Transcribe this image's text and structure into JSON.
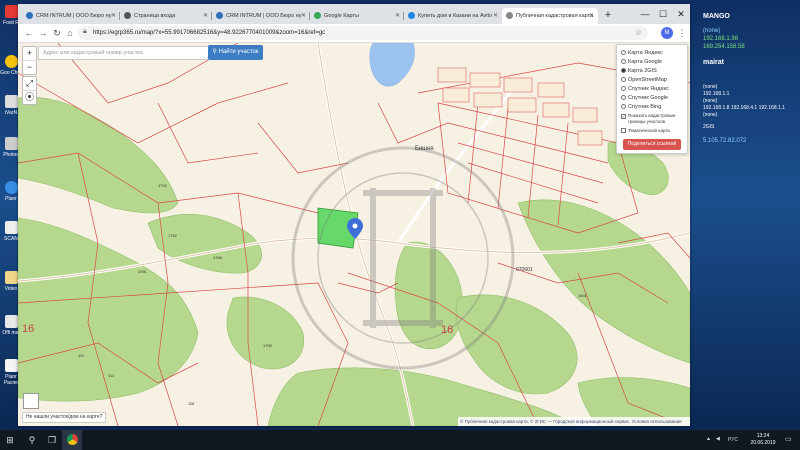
{
  "desktop": {
    "icons": [
      {
        "label": "Foxit R"
      },
      {
        "label": "Goo Chro"
      },
      {
        "label": "iVarN"
      },
      {
        "label": "Photos"
      },
      {
        "label": "Planr"
      },
      {
        "label": "SCAN"
      },
      {
        "label": "Video"
      },
      {
        "label": "Offi mai"
      },
      {
        "label": "Planr Распе"
      }
    ]
  },
  "bginfo": {
    "hostname": "MANGO",
    "none1": "(none)",
    "ip1": "192.168.1.98",
    "ip2": "169.254.158.58",
    "user": "mairat",
    "none2": "(none)",
    "ip3": "192.168.1.1",
    "none3": "(none)",
    "ip4": "192.168.1.8 192.168.4.1 192.168.1.1",
    "none4": "(none)",
    "fs": "2GIS",
    "ext_ip": "5.105.72.82.072"
  },
  "browser": {
    "tabs": [
      {
        "title": "CRM INTRUM | ООО Бюро ну",
        "color": "#2d6fb8"
      },
      {
        "title": "Страница входа",
        "color": "#555"
      },
      {
        "title": "CRM INTRUM | ООО Бюро ну",
        "color": "#2d6fb8"
      },
      {
        "title": "Google Карты",
        "color": "#34a853"
      },
      {
        "title": "Купить дом в Казани на Avito",
        "color": "#1e88e5"
      },
      {
        "title": "Публичная кадастровая карта",
        "color": "#888"
      }
    ],
    "new_tab": "+",
    "minimize": "—",
    "maximize": "☐",
    "close": "✕",
    "url": "https://egrp365.ru/map/?x=55.991706682516&y=48.9226770401009&zoom=16&ref=gc",
    "avatar_letter": "М"
  },
  "map": {
    "search_placeholder": "Адрес или кадастровый номер участка",
    "find_button": "Найти участок",
    "zoom_in": "+",
    "zoom_out": "−",
    "layers": [
      {
        "label": "Карта Яндекс",
        "selected": false
      },
      {
        "label": "Карта Google",
        "selected": false
      },
      {
        "label": "Карта 2GIS",
        "selected": true
      },
      {
        "label": "OpenStreetMap",
        "selected": false
      },
      {
        "label": "Спутник Яндекс",
        "selected": false
      },
      {
        "label": "Спутник Google",
        "selected": false
      },
      {
        "label": "Спутник Bing",
        "selected": false
      }
    ],
    "show_borders_line1": "Показать кадастровые",
    "show_borders_line2": "границы участков",
    "thematic": "Тематическая карта",
    "share_button": "Поделиться ссылкой",
    "feedback": "Не нашли участок/дом на карте?",
    "attribution": "© Публичная кадастровая карта, © 2ГИС — Городской информационный сервис. Условия использования",
    "place_label": "Бишня",
    "parcel_number": "070601",
    "big_numbers": [
      "16",
      "16"
    ],
    "parcel_labels": [
      "1792",
      "1762",
      "1766",
      "111",
      "112",
      "118",
      "2091",
      "1700",
      "1691"
    ]
  },
  "taskbar": {
    "start": "⊞",
    "search": "⚲",
    "taskview": "❐",
    "tray_lang": "РУС",
    "time": "13:24",
    "date": "20.06.2019"
  },
  "colors": {
    "forest": "#b5d88e",
    "water": "#9cc3f0",
    "highlight": "#66d96a",
    "boundary": "#d84848",
    "road": "#ffffff"
  }
}
